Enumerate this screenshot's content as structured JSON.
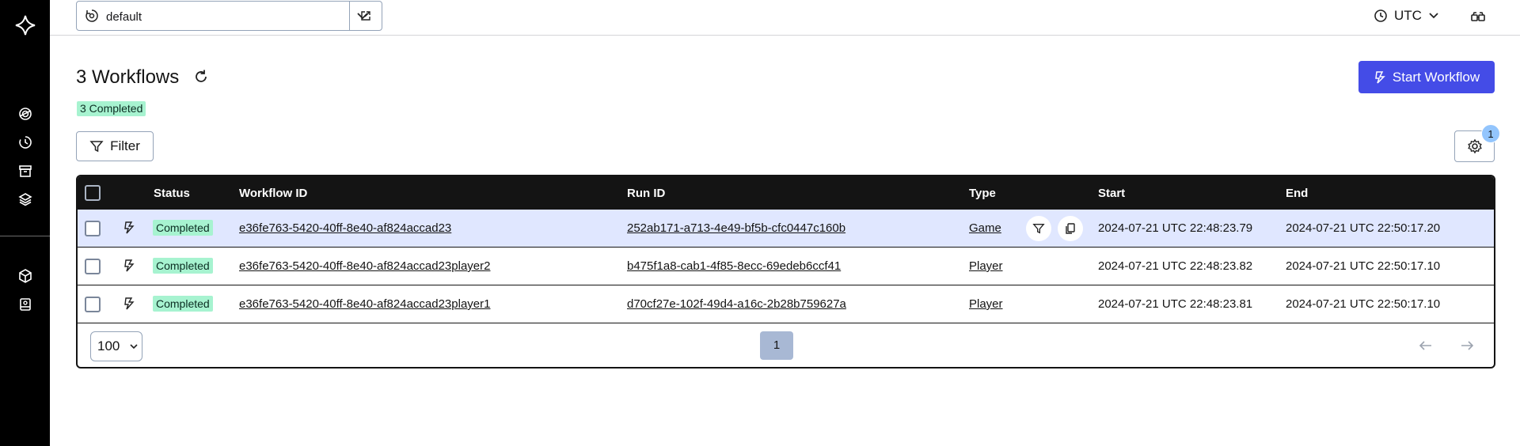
{
  "topbar": {
    "namespace": "default",
    "timezone": "UTC"
  },
  "header": {
    "title": "3 Workflows",
    "start_label": "Start Workflow",
    "completed_badge": "3 Completed",
    "filter_label": "Filter",
    "settings_count": "1"
  },
  "table": {
    "headers": {
      "status": "Status",
      "workflow_id": "Workflow ID",
      "run_id": "Run ID",
      "type": "Type",
      "start": "Start",
      "end": "End"
    },
    "rows": [
      {
        "status": "Completed",
        "workflow_id": "e36fe763-5420-40ff-8e40-af824accad23",
        "run_id": "252ab171-a713-4e49-bf5b-cfc0447c160b",
        "type": "Game",
        "start": "2024-07-21 UTC 22:48:23.79",
        "end": "2024-07-21 UTC 22:50:17.20"
      },
      {
        "status": "Completed",
        "workflow_id": "e36fe763-5420-40ff-8e40-af824accad23player2",
        "run_id": "b475f1a8-cab1-4f85-8ecc-69edeb6ccf41",
        "type": "Player",
        "start": "2024-07-21 UTC 22:48:23.82",
        "end": "2024-07-21 UTC 22:50:17.10"
      },
      {
        "status": "Completed",
        "workflow_id": "e36fe763-5420-40ff-8e40-af824accad23player1",
        "run_id": "d70cf27e-102f-49d4-a16c-2b28b759627a",
        "type": "Player",
        "start": "2024-07-21 UTC 22:48:23.81",
        "end": "2024-07-21 UTC 22:50:17.10"
      }
    ]
  },
  "pagination": {
    "page_size": "100",
    "current_page": "1"
  },
  "colors": {
    "sidebar": "#000000",
    "primary": "#444ce7",
    "status_completed": "#a7f3d0",
    "selected_row": "#e0e7ff"
  }
}
